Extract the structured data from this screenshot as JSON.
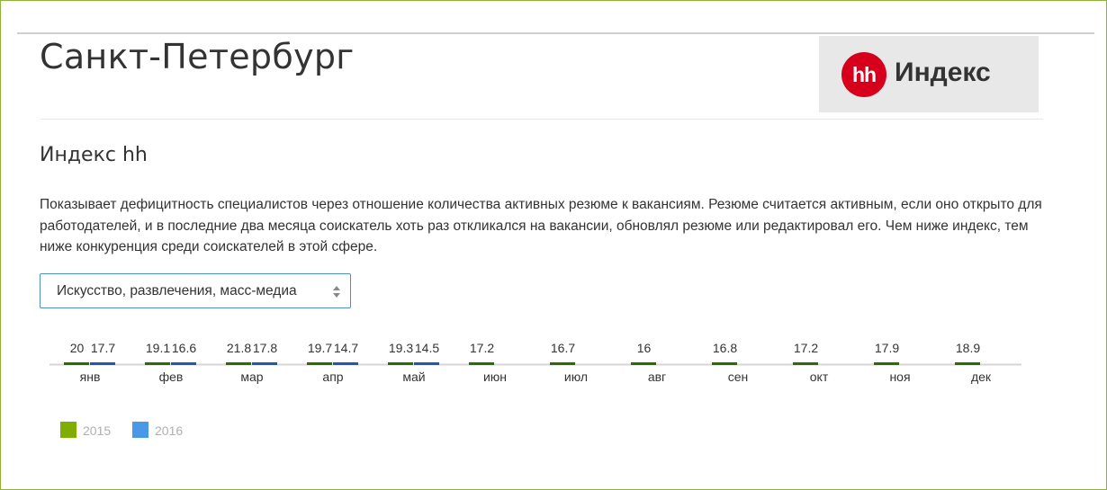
{
  "page": {
    "city": "Санкт-Петербург",
    "logo": {
      "mark": "hh",
      "word": "Индекс"
    },
    "section_title": "Индекс hh",
    "description": "Показывает дефицитность специалистов через отношение количества активных резюме к вакансиям. Резюме считается активным, если оно открыто для работодателей, и в последние два месяца соискатель хоть раз откликался на вакансии, обновлял резюме или редактировал его. Чем ниже индекс, тем ниже конкуренция среди соискателей в этой сфере.",
    "dropdown": {
      "selected": "Искусство, развлечения, масс-медиа",
      "icon": "select-arrows-icon"
    }
  },
  "colors": {
    "accent_green": "#7aa300",
    "series_2015": "#2e6b00",
    "series_2016": "#1e5aa8",
    "legend_2015": "#7fae00",
    "legend_2016": "#4a98e8",
    "logo_red": "#d6001c"
  },
  "chart_data": {
    "type": "bar",
    "categories": [
      "янв",
      "фев",
      "мар",
      "апр",
      "май",
      "июн",
      "июл",
      "авг",
      "сен",
      "окт",
      "ноя",
      "дек"
    ],
    "series": [
      {
        "name": "2015",
        "values": [
          20,
          19.1,
          21.8,
          19.7,
          19.3,
          17.2,
          16.7,
          16,
          16.8,
          17.2,
          17.9,
          18.9
        ]
      },
      {
        "name": "2016",
        "values": [
          17.7,
          16.6,
          17.8,
          14.7,
          14.5,
          null,
          null,
          null,
          null,
          null,
          null,
          null
        ]
      }
    ],
    "value_labels": [
      [
        "20",
        "19.1",
        "21.8",
        "19.7",
        "19.3",
        "17.2",
        "16.7",
        "16",
        "16.8",
        "17.2",
        "17.9",
        "18.9"
      ],
      [
        "17.7",
        "16.6",
        "17.8",
        "14.7",
        "14.5",
        null,
        null,
        null,
        null,
        null,
        null,
        null
      ]
    ],
    "legend": [
      "2015",
      "2016"
    ],
    "legend_position": "bottom-left"
  }
}
